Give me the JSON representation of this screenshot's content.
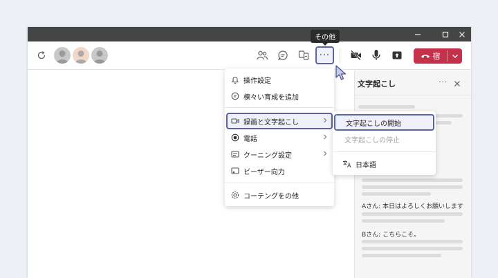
{
  "toolbar": {
    "tooltip": "その他",
    "more_label": "···",
    "leave_label": "宿",
    "colors": {
      "accent": "#5b63a8",
      "leave": "#c4314b"
    },
    "icons": [
      "refresh-icon",
      "people-icon",
      "chat-icon",
      "apps-icon",
      "video-off-icon",
      "mic-icon",
      "share-icon",
      "phone-hangup-icon",
      "chevron-down-icon"
    ]
  },
  "menu": {
    "items": [
      {
        "label": "操作設定",
        "icon": "bell-icon"
      },
      {
        "label": "楝々い育成を追加",
        "icon": "add-chat-icon"
      },
      {
        "label": "録画と文字起こし",
        "icon": "record-icon"
      },
      {
        "label": "電話",
        "icon": "radio-icon"
      },
      {
        "label": "クーニング設定",
        "icon": "meeting-settings-icon"
      },
      {
        "label": "ビーザー向力",
        "icon": "laser-icon"
      },
      {
        "label": "コーテングをの他",
        "icon": "gear-icon"
      }
    ]
  },
  "submenu": {
    "items": [
      {
        "label": "文字起こしの開始"
      },
      {
        "label": "文字起こしの停止"
      },
      {
        "label": "日本語",
        "icon": "translate-icon"
      }
    ]
  },
  "side_panel": {
    "title": "文字起こし",
    "more_label": "···",
    "messages": [
      "Aさん: 本日はよろしくお願いします",
      "Bさん: こちらこそ。"
    ]
  }
}
